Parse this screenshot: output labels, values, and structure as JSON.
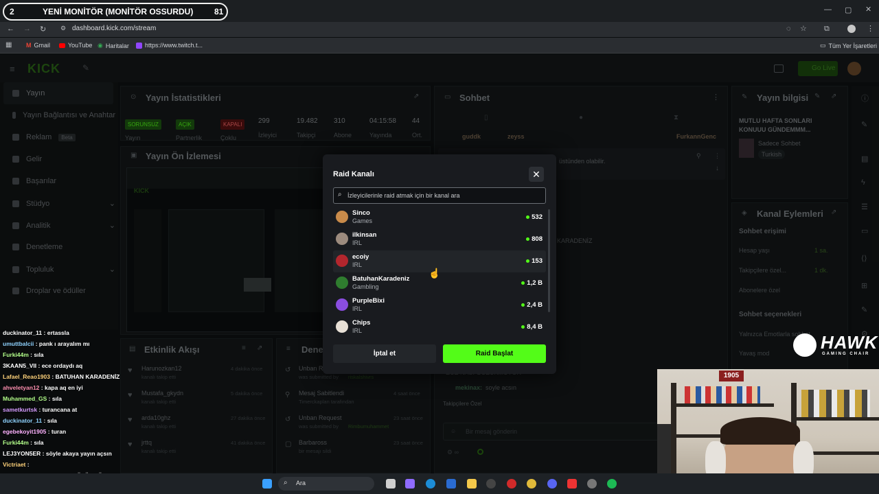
{
  "overlay": {
    "rank": "2",
    "stream_title": "YENİ MONİTÖR (MONİTÖR OSSURDU)",
    "count": "81",
    "hawk": {
      "brand": "HAWK",
      "sub": "GAMING CHAIR"
    }
  },
  "browser": {
    "url": "dashboard.kick.com/stream",
    "bookmarks": [
      "Gmail",
      "YouTube",
      "Haritalar",
      "https://www.twitch.t..."
    ],
    "all_bookmarks": "Tüm Yer İşaretleri"
  },
  "app": {
    "go_live": "Go Live",
    "sidebar": [
      {
        "label": "Yayın",
        "active": true
      },
      {
        "label": "Yayın Bağlantısı ve Anahtar"
      },
      {
        "label": "Reklam",
        "badge": "Beta"
      },
      {
        "label": "Gelir"
      },
      {
        "label": "Başarılar"
      },
      {
        "label": "Stüdyo",
        "chevron": true
      },
      {
        "label": "Analitik",
        "chevron": true
      },
      {
        "label": "Denetleme"
      },
      {
        "label": "Topluluk",
        "chevron": true
      },
      {
        "label": "Droplar ve ödüller"
      }
    ],
    "stats": {
      "title": "Yayın İstatistikleri",
      "badges": [
        "SORUNSUZ",
        "AÇIK",
        "KAPALI"
      ],
      "badge_labels": [
        "Yayın",
        "Partnerlik",
        "Çoklu"
      ],
      "values": [
        "299",
        "19.482",
        "310",
        "04:15:58",
        "44"
      ],
      "labels": [
        "İzleyici",
        "Takipçi",
        "Abone",
        "Yayında",
        "Ort."
      ]
    },
    "preview_title": "Yayın Ön İzlemesi",
    "chat": {
      "title": "Sohbet",
      "users": [
        "guddk",
        "zeyss",
        "FurkannGenc"
      ],
      "pinned": "üstünden olabilir.",
      "line1": "KARADENİZ",
      "line2": "ECE NASI GÖZÜKMÜYOR",
      "line3_user": "mekinax:",
      "line3_text": "soyle acsın",
      "followers_only": "Takipçilere Özel",
      "placeholder": "Bir mesaj gönderin"
    },
    "info": {
      "title": "Yayın bilgisi",
      "stream_title": "MUTLU HAFTA SONLARI KONUUU GÜNDEMMM...",
      "category": "Sadece Sohbet",
      "language": "Turkish"
    },
    "actions": {
      "title": "Kanal Eylemleri",
      "chat_access": "Sohbet erişimi",
      "items": [
        {
          "label": "Hesap yaşı",
          "value": "1 sa."
        },
        {
          "label": "Takipçilere özel...",
          "value": "1 dk."
        },
        {
          "label": "Abonelere özel"
        }
      ],
      "chat_options": "Sohbet seçenekleri",
      "emote_only": "Yalnızca Emotlarla sohbet",
      "slow_mode": "Yavaş mod"
    },
    "activity": {
      "title": "Etkinlik Akışı",
      "items": [
        {
          "name": "Harunozkan12",
          "sub": "kanalı takip etti",
          "time": "4 dakika önce"
        },
        {
          "name": "Mustafa_gkydn",
          "sub": "kanalı takip etti",
          "time": "5 dakika önce"
        },
        {
          "name": "arda10ghz",
          "sub": "kanalı takip etti",
          "time": "27 dakika önce"
        },
        {
          "name": "jrttq",
          "sub": "kanalı takip etti",
          "time": "41 dakika önce"
        }
      ]
    },
    "moderation": {
      "title": "Dene",
      "items": [
        {
          "name": "Unban Request",
          "sub": "was submitted by",
          "user": "riskalshivrs",
          "time": ""
        },
        {
          "name": "Mesaj Sabitlendi",
          "sub": "Timerckaplan tarafından",
          "user": "",
          "time": "4 saat önce"
        },
        {
          "name": "Unban Request",
          "sub": "was submitted by",
          "user": "Rimbumuhammet",
          "time": "23 saat önce"
        },
        {
          "name": "Barbaross",
          "sub": "bir mesajı sildi",
          "user": "",
          "time": "23 saat önce"
        }
      ]
    }
  },
  "modal": {
    "title": "Raid Kanalı",
    "search_placeholder": "İzleyicilerinle raid atmak için bir kanal ara",
    "channels": [
      {
        "name": "Sinco",
        "category": "Games",
        "viewers": "532",
        "color": "#c98b4a"
      },
      {
        "name": "ilkinsan",
        "category": "IRL",
        "viewers": "808",
        "color": "#9c8b7e"
      },
      {
        "name": "ecoiy",
        "category": "IRL",
        "viewers": "153",
        "color": "#b3262d"
      },
      {
        "name": "BatuhanKaradeniz",
        "category": "Gambling",
        "viewers": "1,2 B",
        "color": "#2f7d2f"
      },
      {
        "name": "PurpleBixi",
        "category": "IRL",
        "viewers": "2,4 B",
        "color": "#8a4de0"
      },
      {
        "name": "Chips",
        "category": "IRL",
        "viewers": "8,4 B",
        "color": "#e8e0d6"
      }
    ],
    "cancel": "İptal et",
    "start": "Raid Başlat"
  },
  "chatlog": [
    {
      "user": "duckinator_11",
      "msg": "ertassla",
      "color": "#ffffff"
    },
    {
      "user": "umuttbalcii",
      "msg": "pank ı arayalım mı",
      "color": "#8fd3ff"
    },
    {
      "user": "Furki44m",
      "msg": "sıla",
      "color": "#b3ff8a"
    },
    {
      "user": "3KAAN5_VII",
      "msg": "ece ordaydı aq",
      "color": "#ffffff"
    },
    {
      "user": "Lafael_Reao1903",
      "msg": "BATUHAN KARADENİZ",
      "color": "#ffd27a"
    },
    {
      "user": "ahveletyan12",
      "msg": "kapa aq en iyi",
      "color": "#ff8fb0"
    },
    {
      "user": "Muhammed_GS",
      "msg": "sıla",
      "color": "#b3ff8a"
    },
    {
      "user": "sametkurtsk",
      "msg": "turancana at",
      "color": "#d59bff"
    },
    {
      "user": "duckinator_11",
      "msg": "sıla",
      "color": "#8fd3ff"
    },
    {
      "user": "egebekoyit1905",
      "msg": "turan",
      "color": "#ffb3ff"
    },
    {
      "user": "Furki44m",
      "msg": "sıla",
      "color": "#b3ff8a"
    },
    {
      "user": "LEJ3YON5ER",
      "msg": "söyle akaya yayın açsın",
      "color": "#ffffff"
    },
    {
      "user": "Victriaet",
      "msg": "",
      "color": "#ffd27a"
    },
    {
      "user": "AloneeeXDD",
      "msg": "ECE NASI GÖZÜKMÜYOR",
      "color": "#ffffff"
    },
    {
      "user": "mekinax",
      "msg": "söyle acsın",
      "color": "#ffffff"
    }
  ],
  "taskbar": {
    "search": "Ara"
  }
}
